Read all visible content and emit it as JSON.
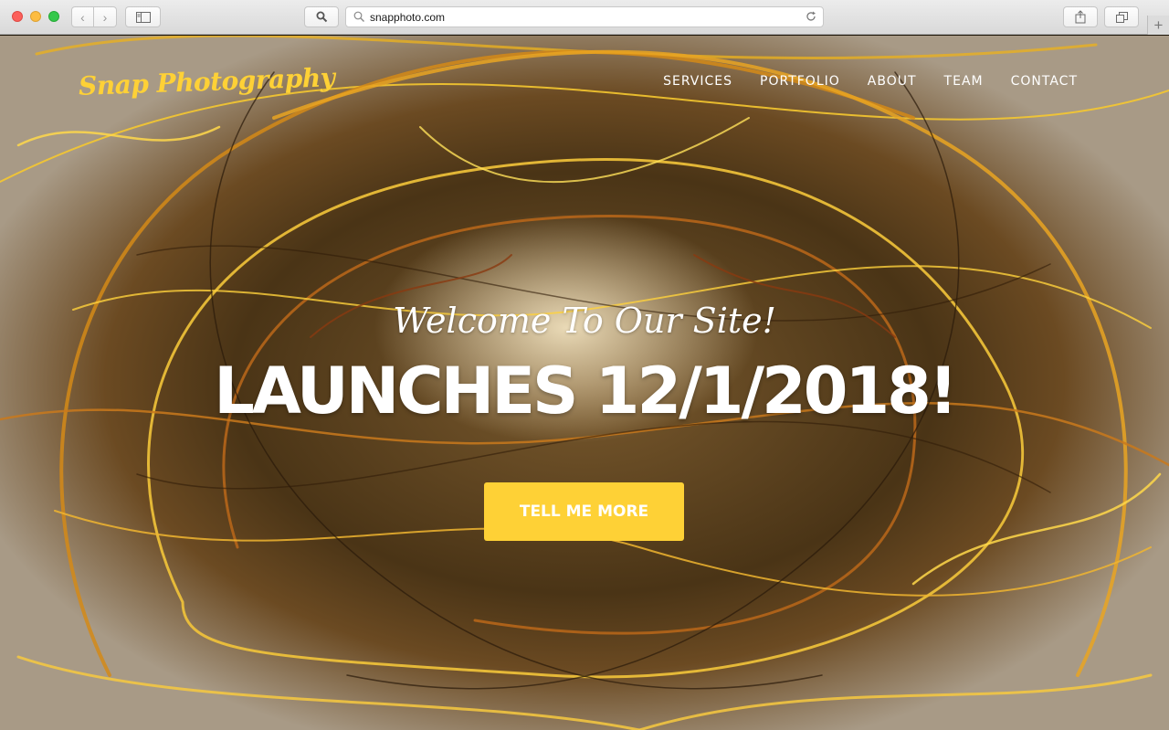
{
  "browser": {
    "url": "snapphoto.com",
    "icons": [
      "back-icon",
      "forward-icon",
      "sidebar-icon",
      "search-icon",
      "reload-icon",
      "share-icon",
      "tabs-icon",
      "add-tab-icon"
    ]
  },
  "site": {
    "brand": "Snap Photography",
    "nav": [
      {
        "label": "SERVICES"
      },
      {
        "label": "PORTFOLIO"
      },
      {
        "label": "ABOUT"
      },
      {
        "label": "TEAM"
      },
      {
        "label": "CONTACT"
      }
    ],
    "hero": {
      "lead": "Welcome To Our Site!",
      "heading": "LAUNCHES 12/1/2018!",
      "button": "TELL ME MORE"
    }
  },
  "colors": {
    "accent": "#fed136",
    "hero_text": "#ffffff"
  }
}
